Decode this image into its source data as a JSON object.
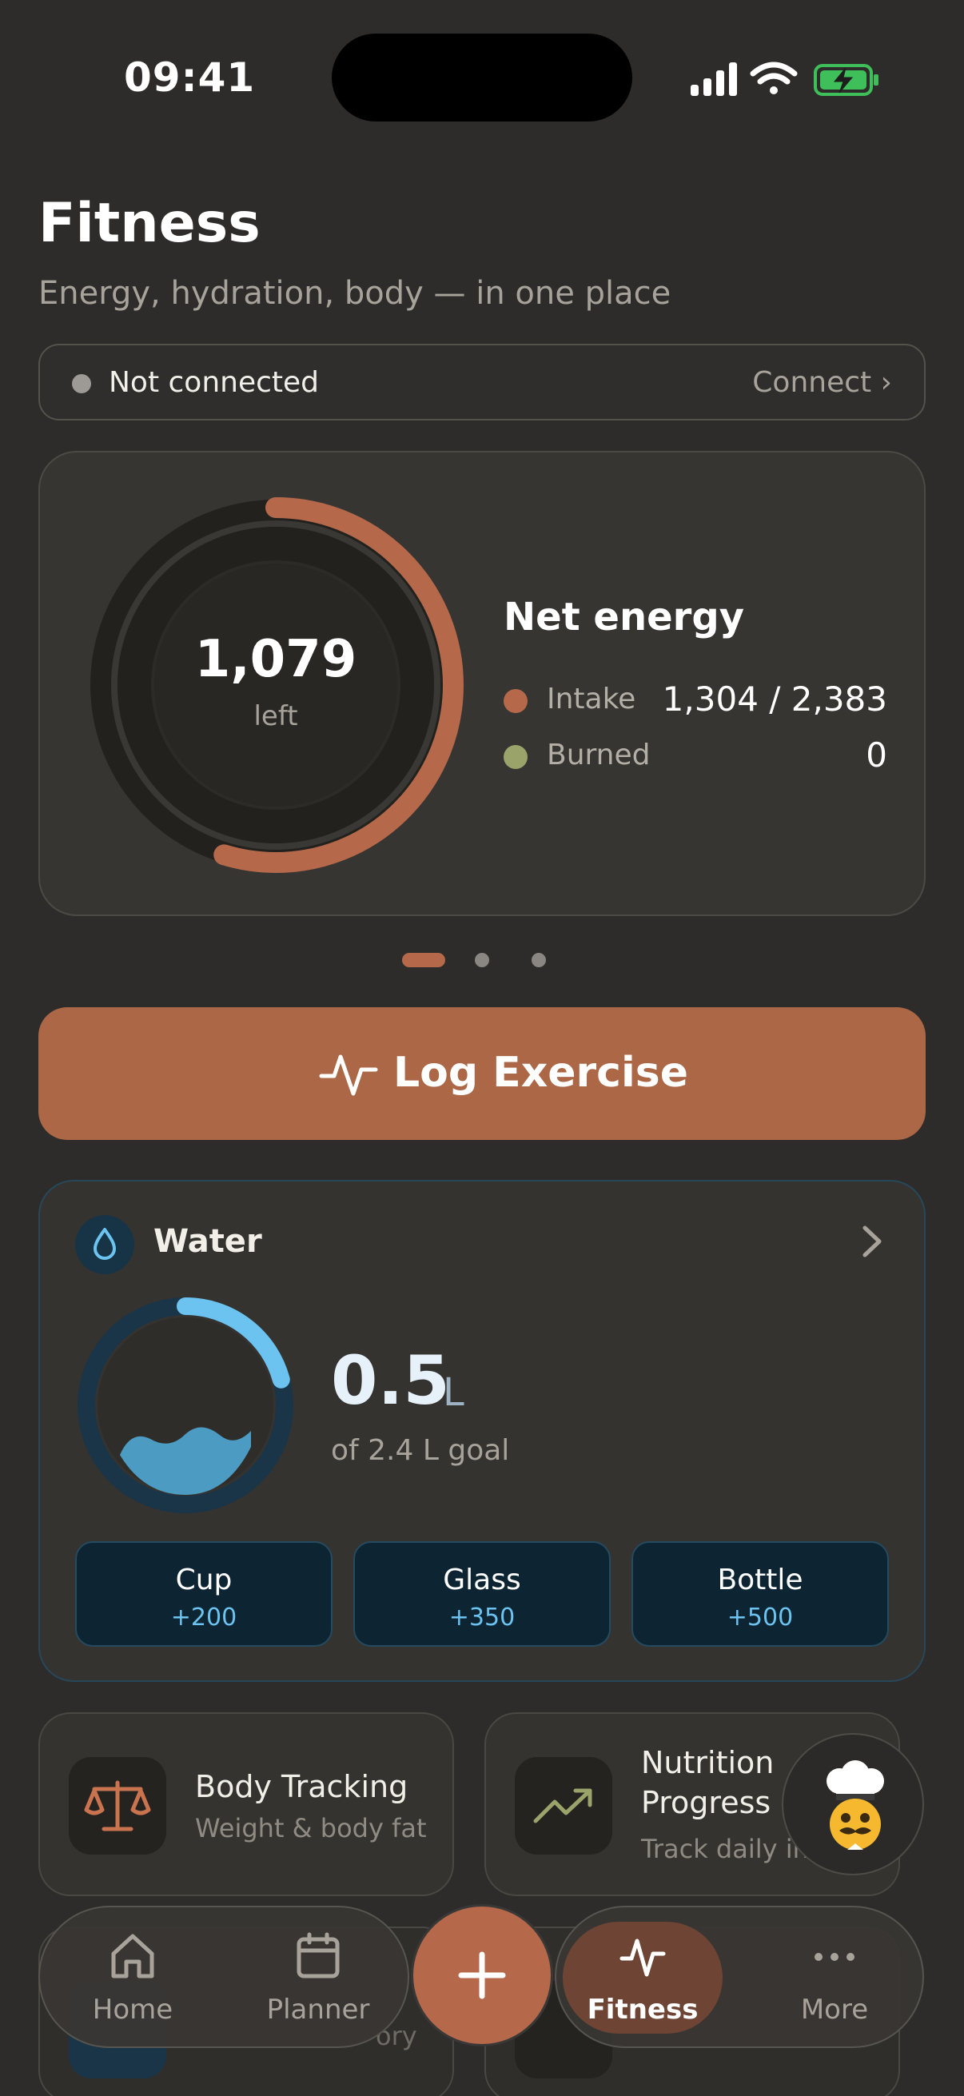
{
  "status_bar": {
    "time": "09:41"
  },
  "header": {
    "title": "Fitness",
    "subtitle": "Energy, hydration, body — in one place"
  },
  "connection": {
    "status": "Not connected",
    "action": "Connect ›"
  },
  "energy": {
    "remaining": "1,079",
    "remaining_label": "left",
    "title": "Net energy",
    "intake_label": "Intake",
    "intake_value": "1,304 / 2,383",
    "burned_label": "Burned",
    "burned_value": "0",
    "intake_fraction": 0.547,
    "intake_color": "#b5694a",
    "burned_color": "#9aa36a"
  },
  "carousel": {
    "pages": 3,
    "active": 0
  },
  "log_exercise": {
    "label": "Log Exercise"
  },
  "water": {
    "title": "Water",
    "amount": "0.5",
    "unit": "L",
    "goal": "of 2.4 L goal",
    "fraction": 0.208,
    "accent": "#6cc3f0",
    "buttons": [
      {
        "label": "Cup",
        "amount": "+200"
      },
      {
        "label": "Glass",
        "amount": "+350"
      },
      {
        "label": "Bottle",
        "amount": "+500"
      }
    ]
  },
  "tiles": [
    {
      "title": "Body Tracking",
      "subtitle": "Weight & body fat",
      "icon": "scale-icon"
    },
    {
      "title_line1": "Nutrition",
      "title_line2": "Progress",
      "subtitle": "Track daily in",
      "icon": "trending-up-icon"
    }
  ],
  "bottom_tiles_partial": {
    "left_fragment": "ory"
  },
  "chef_button": {
    "icon": "chef-mascot-icon"
  },
  "tab_bar": {
    "items": [
      {
        "label": "Home",
        "icon": "home-icon"
      },
      {
        "label": "Planner",
        "icon": "calendar-icon"
      },
      {
        "label": "Fitness",
        "icon": "activity-icon",
        "active": true
      },
      {
        "label": "More",
        "icon": "more-icon"
      }
    ],
    "fab_icon": "plus-icon"
  },
  "colors": {
    "background": "#2d2c2a",
    "accent": "#b5694a",
    "water": "#6cc3f0"
  }
}
